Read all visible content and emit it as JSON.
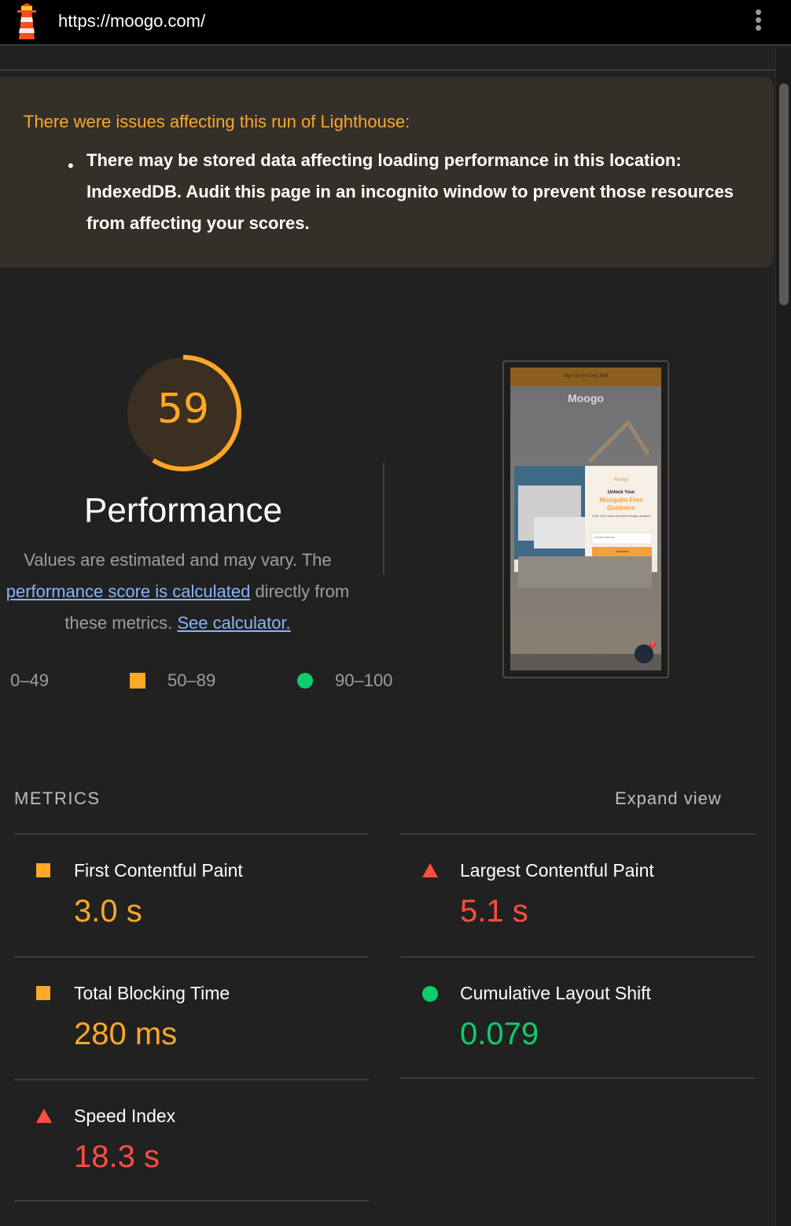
{
  "topbar": {
    "url": "https://moogo.com/",
    "logo_icon": "lighthouse-icon",
    "menu_icon": "kebab-menu-icon"
  },
  "warning": {
    "title": "There were issues affecting this run of Lighthouse:",
    "message": "There may be stored data affecting loading performance in this location: IndexedDB. Audit this page in an incognito window to prevent those resources from affecting your scores."
  },
  "performance": {
    "score": "59",
    "score_fraction": 0.59,
    "title": "Performance",
    "desc_line1": "Values are estimated and may vary. The",
    "desc_link": "performance score is calculated",
    "desc_after_link": " directly from",
    "desc_line3": "these metrics. ",
    "calculator_link": "See calculator."
  },
  "legend": {
    "fail": "0–49",
    "average": "50–89",
    "pass": "90–100"
  },
  "screenshot": {
    "banner": "Sign up for Early Bird",
    "brand": "Moogo",
    "popup_brand": "Moogo",
    "popup_heading1": "Unlock Your",
    "popup_heading2": "Mosquito-Free",
    "popup_heading3": "Outdoors",
    "popup_sub": "& Be The First to Receive Moogo Updates",
    "popup_input": "Email Address",
    "popup_button": "Continue",
    "chat_badge": "1"
  },
  "metrics": {
    "header": "METRICS",
    "expand": "Expand view",
    "items": [
      {
        "label": "First Contentful Paint",
        "value": "3.0 s",
        "status": "average"
      },
      {
        "label": "Largest Contentful Paint",
        "value": "5.1 s",
        "status": "fail"
      },
      {
        "label": "Total Blocking Time",
        "value": "280 ms",
        "status": "average"
      },
      {
        "label": "Cumulative Layout Shift",
        "value": "0.079",
        "status": "pass"
      },
      {
        "label": "Speed Index",
        "value": "18.3 s",
        "status": "fail"
      }
    ]
  },
  "colors": {
    "average": "#ffa726",
    "fail": "#ff4e42",
    "pass": "#0cce6b",
    "link": "#8ab4f8"
  }
}
